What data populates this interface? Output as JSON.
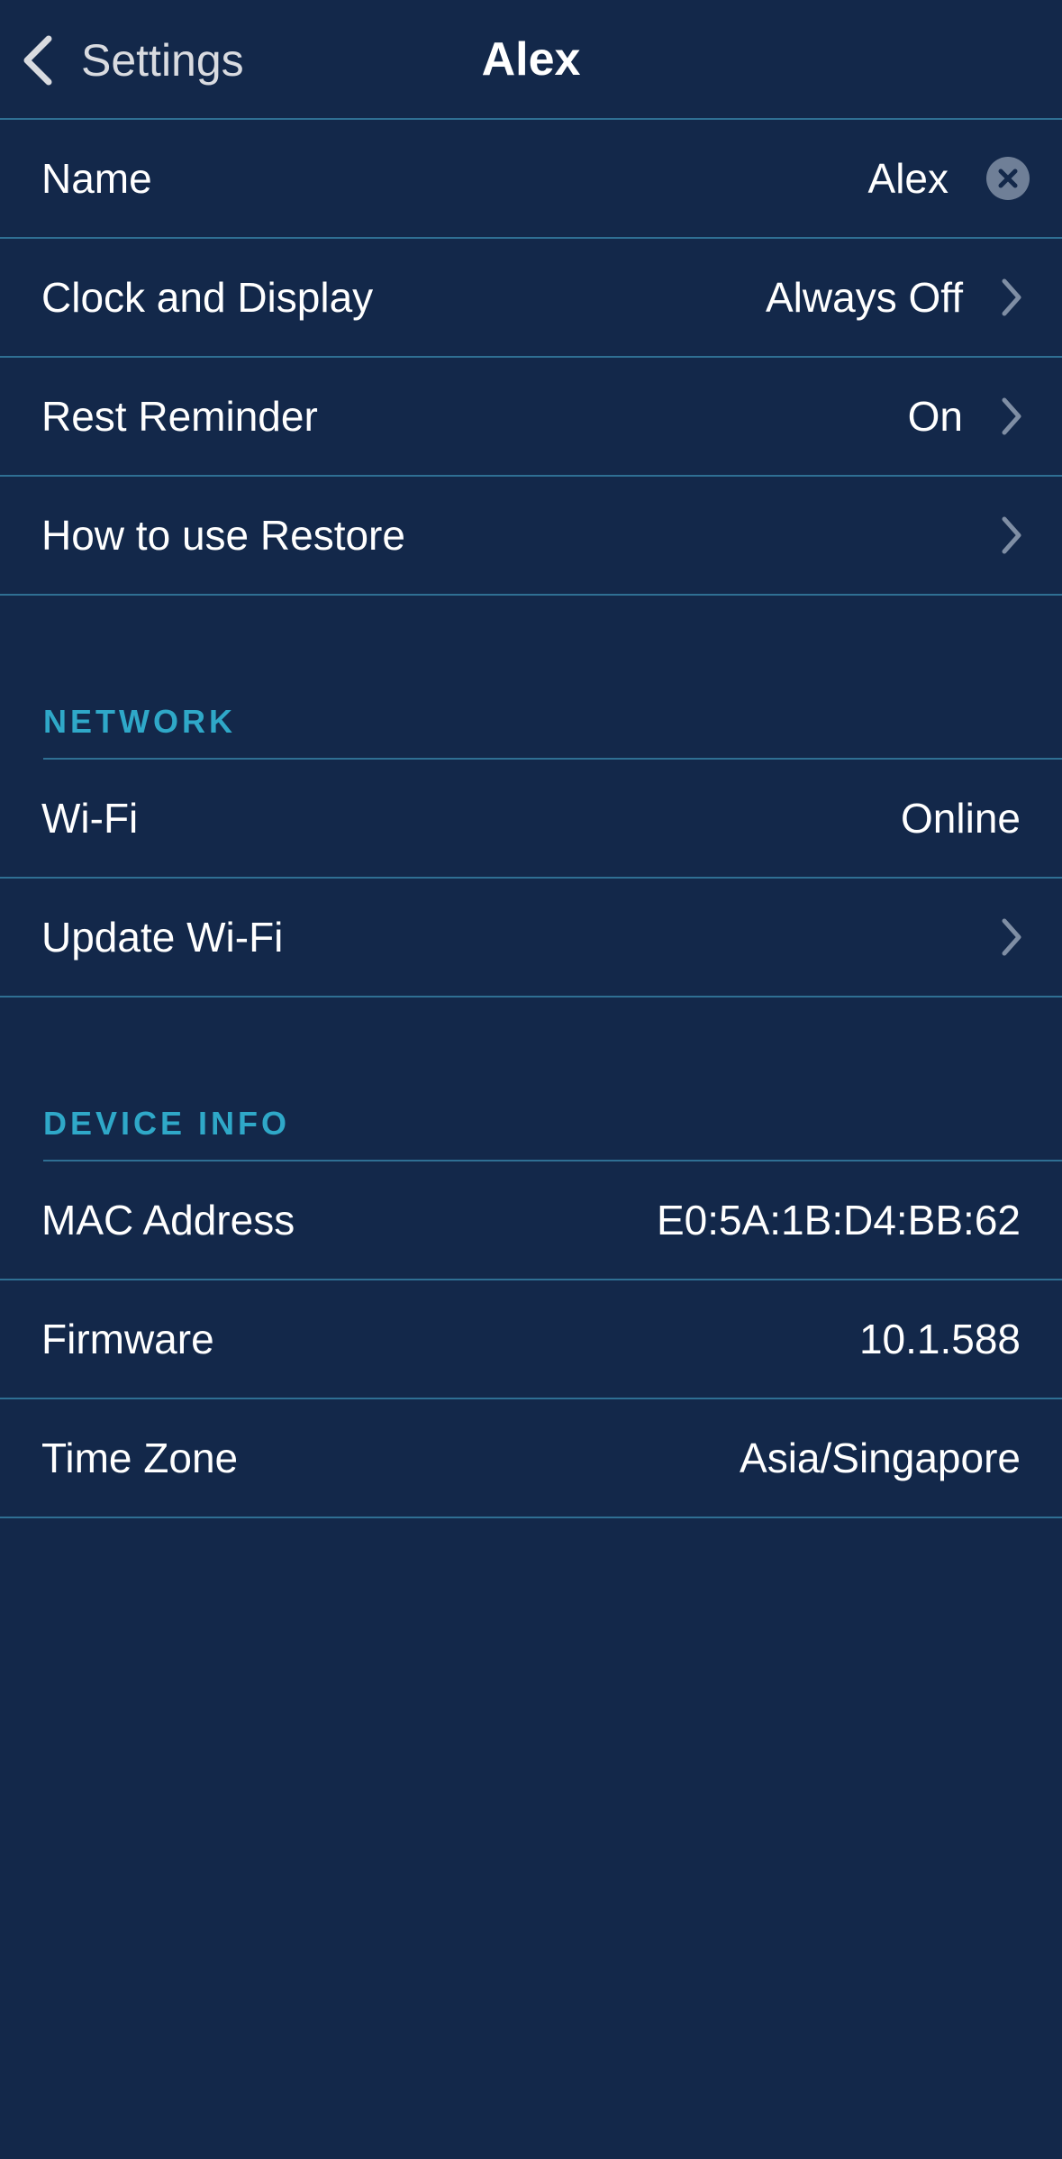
{
  "navbar": {
    "back_label": "Settings",
    "title": "Alex"
  },
  "colors": {
    "background": "#13284a",
    "divider": "#2f6f93",
    "section_header": "#2fa8c8",
    "chevron": "#7f8ea4",
    "clear_icon": "#6f7f97"
  },
  "general": {
    "name": {
      "label": "Name",
      "value": "Alex"
    },
    "clock": {
      "label": "Clock and Display",
      "value": "Always Off"
    },
    "rest": {
      "label": "Rest Reminder",
      "value": "On"
    },
    "howto": {
      "label": "How to use Restore"
    }
  },
  "network": {
    "header": "NETWORK",
    "wifi": {
      "label": "Wi-Fi",
      "value": "Online"
    },
    "update": {
      "label": "Update Wi-Fi"
    }
  },
  "device_info": {
    "header": "DEVICE INFO",
    "mac": {
      "label": "MAC Address",
      "value": "E0:5A:1B:D4:BB:62"
    },
    "firmware": {
      "label": "Firmware",
      "value": "10.1.588"
    },
    "timezone": {
      "label": "Time Zone",
      "value": "Asia/Singapore"
    }
  }
}
